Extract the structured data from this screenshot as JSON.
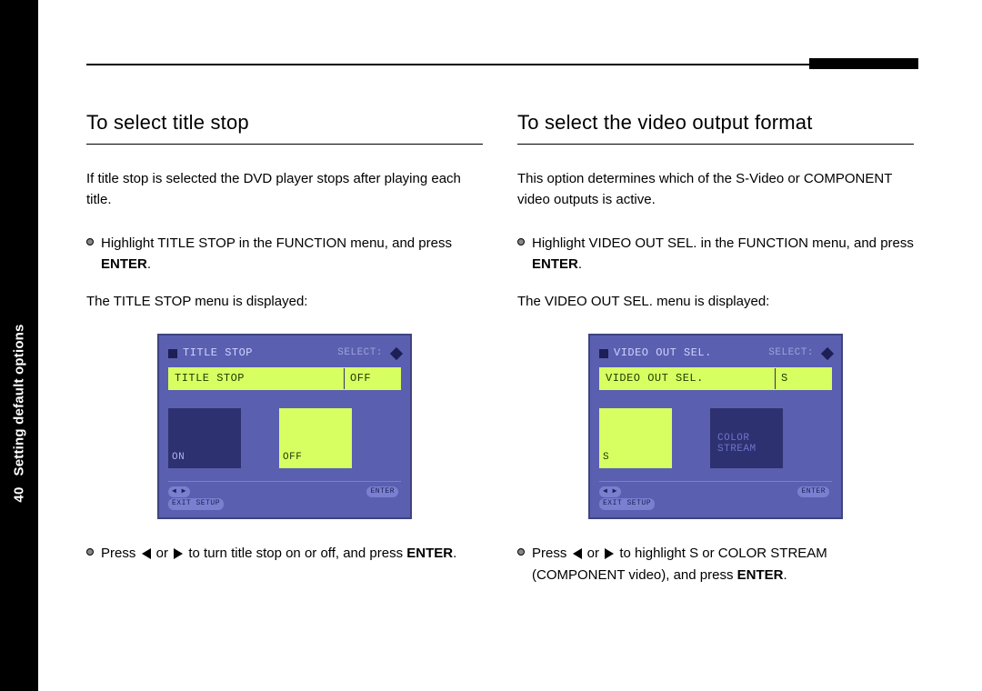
{
  "spine": {
    "page_number": "40",
    "section_title": "Setting default options"
  },
  "left": {
    "heading": "To select title stop",
    "intro": "If title stop is selected the DVD player stops after playing each title.",
    "step1_pre": "Highlight TITLE STOP in the FUNCTION menu, and press ",
    "step1_bold": "ENTER",
    "step1_post": ".",
    "displayed": "The TITLE STOP menu is displayed:",
    "osd": {
      "title": "TITLE STOP",
      "select": "SELECT:",
      "row_label": "TITLE STOP",
      "row_value": "OFF",
      "pane_a": "ON",
      "pane_b": "OFF",
      "footer_left_a": "◀ ▶",
      "footer_left_b": "EXIT SETUP",
      "footer_right": "ENTER"
    },
    "step2_pre": "Press ",
    "step2_mid": " or ",
    "step2_post": " to turn title stop on or off, and press ",
    "step2_bold": "ENTER",
    "step2_end": "."
  },
  "right": {
    "heading": "To select the video output format",
    "intro": "This option determines which of the S-Video or COMPONENT video outputs is active.",
    "step1_pre": "Highlight VIDEO OUT SEL. in the FUNCTION menu, and press ",
    "step1_bold": "ENTER",
    "step1_post": ".",
    "displayed": "The VIDEO OUT SEL. menu is displayed:",
    "osd": {
      "title": "VIDEO OUT SEL.",
      "select": "SELECT:",
      "row_label": "VIDEO OUT SEL.",
      "row_value": "S",
      "pane_a": "S",
      "pane_b_l1": "COLOR",
      "pane_b_l2": "STREAM",
      "footer_left_a": "◀ ▶",
      "footer_left_b": "EXIT SETUP",
      "footer_right": "ENTER"
    },
    "step2_pre": "Press ",
    "step2_mid": " or ",
    "step2_post": " to highlight S or COLOR STREAM (COMPONENT video), and press ",
    "step2_bold": "ENTER",
    "step2_end": "."
  }
}
